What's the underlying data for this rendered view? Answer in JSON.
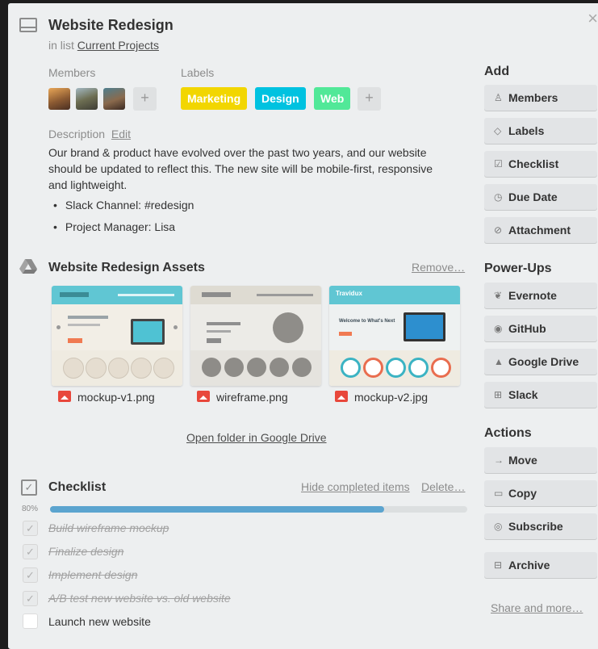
{
  "card": {
    "title": "Website Redesign",
    "list_prefix": "in list",
    "list_name": "Current Projects",
    "close_glyph": "×"
  },
  "members": {
    "heading": "Members",
    "add_glyph": "+"
  },
  "labels": {
    "heading": "Labels",
    "items": [
      {
        "text": "Marketing",
        "color": "#f2d600"
      },
      {
        "text": "Design",
        "color": "#00c2e0"
      },
      {
        "text": "Web",
        "color": "#51e898"
      }
    ],
    "add_glyph": "+"
  },
  "description": {
    "heading": "Description",
    "edit_label": "Edit",
    "text": "Our brand & product have evolved over the past two years, and our website should be updated to reflect this. The new site will be mobile-first, responsive and lightweight.",
    "bullets": [
      "Slack Channel: #redesign",
      "Project Manager: Lisa"
    ]
  },
  "attachments": {
    "title": "Website Redesign Assets",
    "remove_label": "Remove…",
    "files": [
      {
        "name": "mockup-v1.png"
      },
      {
        "name": "wireframe.png"
      },
      {
        "name": "mockup-v2.jpg"
      }
    ],
    "thumb3_brand": "Travidux",
    "thumb3_hero_text": "Welcome to What's Next",
    "open_folder_label": "Open folder in Google Drive"
  },
  "checklist": {
    "title": "Checklist",
    "hide_label": "Hide completed items",
    "delete_label": "Delete…",
    "progress_text": "80%",
    "progress_fraction": 0.8,
    "items": [
      {
        "text": "Build wireframe mockup",
        "done": true
      },
      {
        "text": "Finalize design",
        "done": true
      },
      {
        "text": "Implement design",
        "done": true
      },
      {
        "text": "A/B test new website vs. old website",
        "done": true
      },
      {
        "text": "Launch new website",
        "done": false
      }
    ],
    "check_glyph": "✓"
  },
  "sidebar": {
    "add_heading": "Add",
    "add_buttons": [
      {
        "label": "Members",
        "icon": "person-icon",
        "glyph": "♙"
      },
      {
        "label": "Labels",
        "icon": "tag-icon",
        "glyph": "◇"
      },
      {
        "label": "Checklist",
        "icon": "checkbox-icon",
        "glyph": "☑"
      },
      {
        "label": "Due Date",
        "icon": "clock-icon",
        "glyph": "◷"
      },
      {
        "label": "Attachment",
        "icon": "paperclip-icon",
        "glyph": "⊘"
      }
    ],
    "powerups_heading": "Power-Ups",
    "powerups": [
      {
        "label": "Evernote",
        "icon": "evernote-icon",
        "glyph": "❦"
      },
      {
        "label": "GitHub",
        "icon": "github-icon",
        "glyph": "◉"
      },
      {
        "label": "Google Drive",
        "icon": "google-drive-icon",
        "glyph": "▲"
      },
      {
        "label": "Slack",
        "icon": "slack-icon",
        "glyph": "⊞"
      }
    ],
    "actions_heading": "Actions",
    "actions": [
      {
        "label": "Move",
        "icon": "arrow-right-icon",
        "glyph": "→"
      },
      {
        "label": "Copy",
        "icon": "copy-icon",
        "glyph": "▭"
      },
      {
        "label": "Subscribe",
        "icon": "eye-icon",
        "glyph": "◎"
      },
      {
        "label": "Archive",
        "icon": "archive-icon",
        "glyph": "⊟"
      }
    ],
    "share_label": "Share and more…"
  }
}
